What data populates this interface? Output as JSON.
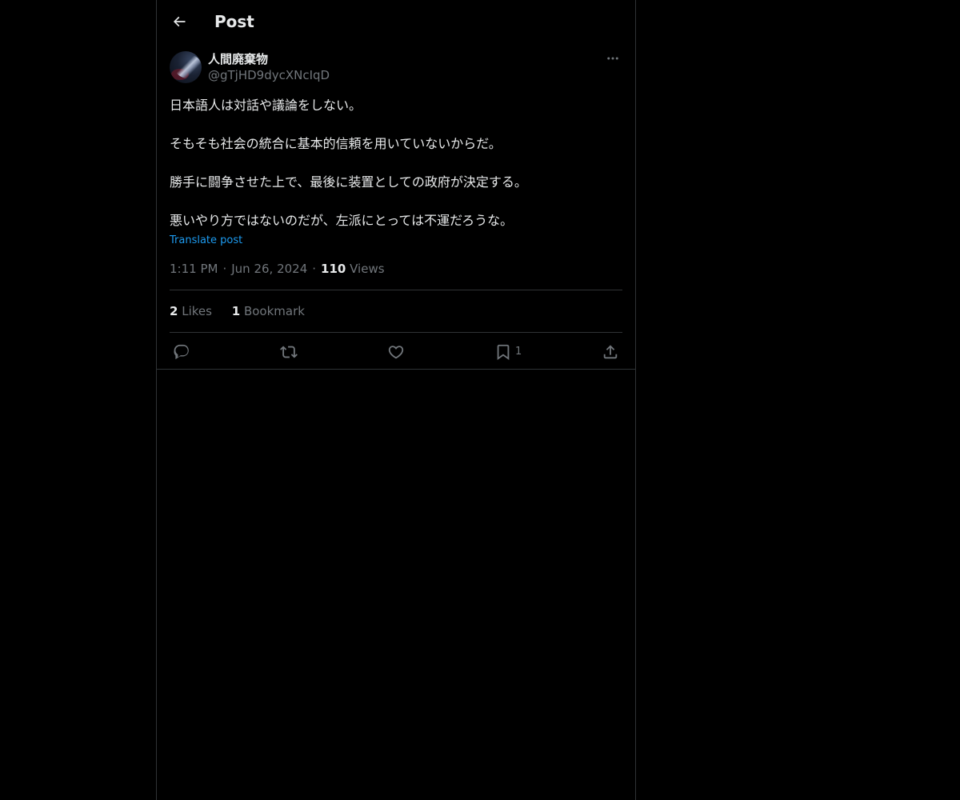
{
  "header": {
    "title": "Post",
    "back_icon": "arrow-left-icon"
  },
  "post": {
    "author": {
      "name": "人間廃棄物",
      "handle": "@gTjHD9dycXNcIqD"
    },
    "paragraphs": [
      "日本語人は対話や議論をしない。",
      "そもそも社会の統合に基本的信頼を用いていないからだ。",
      "勝手に闘争させた上で、最後に装置としての政府が決定する。",
      "悪いやり方ではないのだが、左派にとっては不運だろうな。"
    ],
    "translate_label": "Translate post",
    "time": "1:11 PM",
    "separator": "·",
    "date": "Jun 26, 2024",
    "views_count": "110",
    "views_label": "Views",
    "likes_count": "2",
    "likes_label": "Likes",
    "bookmarks_count": "1",
    "bookmarks_label": "Bookmark"
  },
  "actions": {
    "reply_icon": "reply-icon",
    "repost_icon": "repost-icon",
    "like_icon": "heart-icon",
    "bookmark_icon": "bookmark-icon",
    "bookmark_count": "1",
    "share_icon": "share-icon"
  },
  "colors": {
    "background": "#000000",
    "text_primary": "#e7e9ea",
    "text_secondary": "#71767b",
    "link": "#1d9bf0",
    "border": "#2f3336"
  }
}
